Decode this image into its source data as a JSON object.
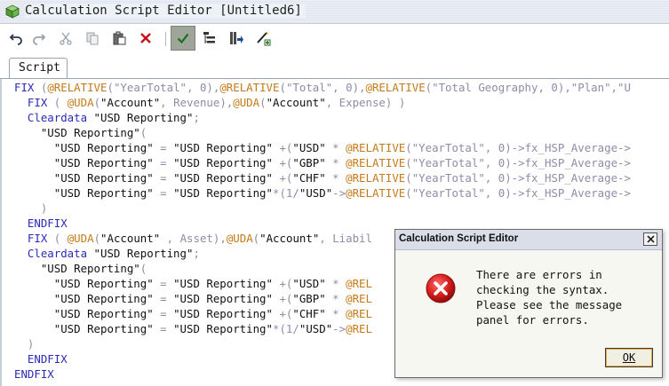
{
  "window": {
    "title": "Calculation Script Editor [Untitled6]"
  },
  "toolbar": {
    "buttons": [
      "undo-icon",
      "redo-icon",
      "cut-icon",
      "copy-icon",
      "paste-icon",
      "delete-icon",
      "validate-icon",
      "outline-icon",
      "execute-icon",
      "member-select-icon"
    ]
  },
  "tabs": [
    {
      "label": "Script"
    }
  ],
  "editor": {
    "lines": [
      "FIX (@RELATIVE(\"YearTotal\", 0),@RELATIVE(\"Total\", 0),@RELATIVE(\"Total Geography, 0),\"Plan\",\"U",
      "  FIX ( @UDA(\"Account\", Revenue),@UDA(\"Account\", Expense) )",
      "  Cleardata \"USD Reporting\";",
      "    \"USD Reporting\"(",
      "      \"USD Reporting\" = \"USD Reporting\" +(\"USD\" * @RELATIVE(\"YearTotal\", 0)->fx_HSP_Average->",
      "      \"USD Reporting\" = \"USD Reporting\" +(\"GBP\" * @RELATIVE(\"YearTotal\", 0)->fx_HSP_Average->",
      "      \"USD Reporting\" = \"USD Reporting\" +(\"CHF\" * @RELATIVE(\"YearTotal\", 0)->fx_HSP_Average->",
      "      \"USD Reporting\" = \"USD Reporting\"*(1/\"USD\"->@RELATIVE(\"YearTotal\", 0)->fx_HSP_Average->",
      "    )",
      "  ENDFIX",
      "  FIX ( @UDA(\"Account\" , Asset),@UDA(\"Account\", Liabil",
      "  Cleardata \"USD Reporting\";",
      "    \"USD Reporting\"(",
      "      \"USD Reporting\" = \"USD Reporting\" +(\"USD\" * @REL",
      "      \"USD Reporting\" = \"USD Reporting\" +(\"GBP\" * @REL",
      "      \"USD Reporting\" = \"USD Reporting\" +(\"CHF\" * @REL",
      "      \"USD Reporting\" = \"USD Reporting\"*(1/\"USD\"->@REL",
      "  )",
      "  ENDFIX",
      "ENDFIX"
    ]
  },
  "dialog": {
    "title": "Calculation Script Editor",
    "message_lines": [
      "There are errors in",
      "checking the syntax.",
      "Please see the message",
      "panel for errors."
    ],
    "ok_label": "OK"
  },
  "colors": {
    "keyword": "#2b2bb8",
    "function": "#c47a18",
    "string": "#8d8da8",
    "error_red": "#d42020"
  }
}
